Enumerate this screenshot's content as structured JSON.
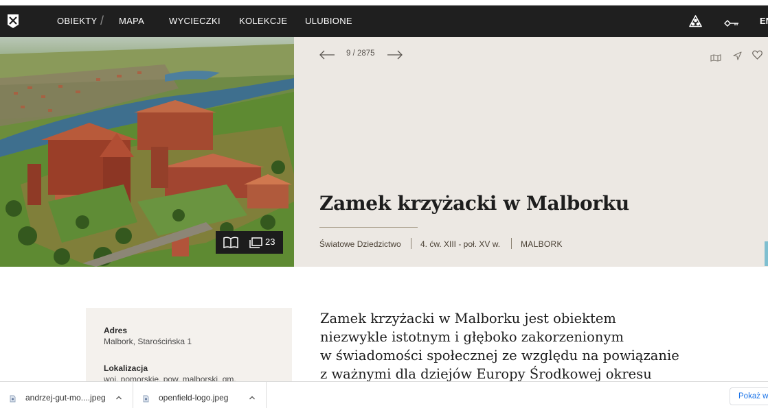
{
  "nav": {
    "items": [
      "OBIEKTY",
      "MAPA",
      "WYCIECZKI",
      "KOLEKCJE",
      "ULUBIONE"
    ],
    "separator": "/",
    "lang": "EN",
    "icons": [
      "logo-icon",
      "network-icon",
      "key-icon"
    ]
  },
  "hero": {
    "pager": {
      "current": "9 / 2875"
    },
    "gallery_count": "23",
    "title": "Zamek krzyżacki w Malborku",
    "meta": {
      "category": "Światowe Dziedzictwo",
      "period": "4. ćw. XIII - poł. XV w.",
      "place": "MALBORK"
    },
    "icons": [
      "map-icon",
      "location-arrow-icon",
      "heart-icon"
    ]
  },
  "info": {
    "address_label": "Adres",
    "address_value": "Malbork, Starościńska 1",
    "location_label": "Lokalizacja",
    "location_value": "woj. pomorskie, pow. malborski, gm."
  },
  "description": {
    "lines": [
      "Zamek krzyżacki w Malborku jest obiektem",
      "niezwykle istotnym i głęboko zakorzenionym",
      "w świadomości społecznej ze względu na powiązanie",
      "z ważnymi dla dziejów Europy Środkowej okresu"
    ]
  },
  "downloads": {
    "items": [
      "andrzej-gut-mo....jpeg",
      "openfield-logo.jpeg"
    ],
    "show_all": "Pokaż ws"
  },
  "colors": {
    "navbar": "#1f1f1f",
    "hero_panel": "#ece8e3",
    "info_box": "#f4f1ed",
    "accent_tab": "#7fbfd0",
    "link_blue": "#1a73e8"
  }
}
